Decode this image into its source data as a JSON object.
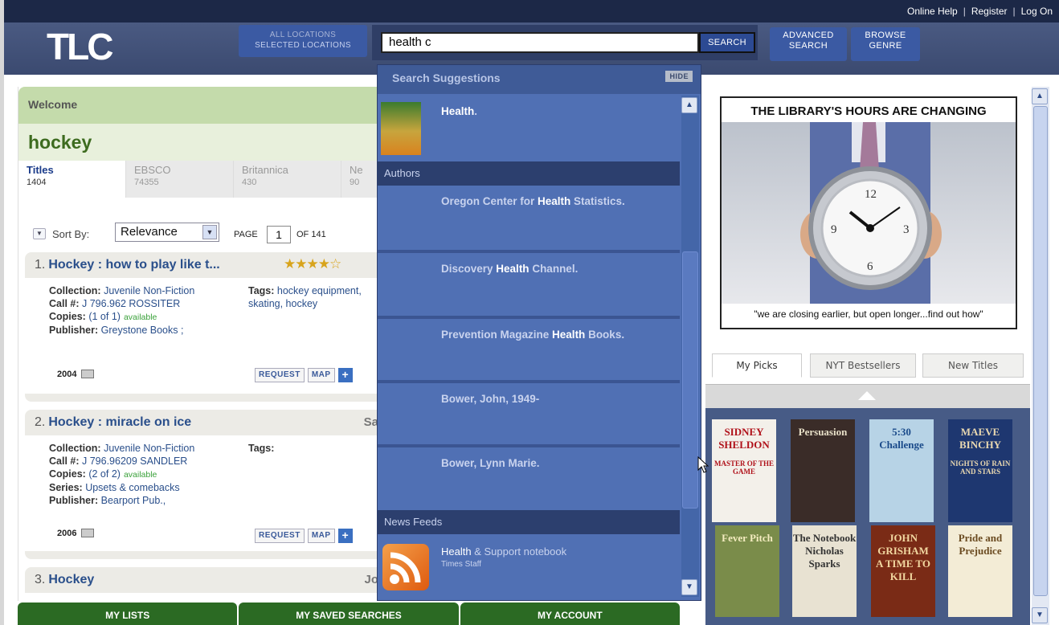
{
  "header": {
    "logo_text": "TLC",
    "top_links": [
      "Online Help",
      "Register",
      "Log On"
    ],
    "locations": {
      "all": "ALL LOCATIONS",
      "selected": "SELECTED LOCATIONS"
    },
    "search": {
      "value": "health c",
      "button": "SEARCH"
    },
    "advanced": {
      "line1": "ADVANCED",
      "line2": "SEARCH"
    },
    "browse": {
      "line1": "BROWSE",
      "line2": "GENRE"
    }
  },
  "welcome": {
    "label": "Welcome",
    "user": "hockey"
  },
  "source_tabs": [
    {
      "name": "Titles",
      "count": "1404"
    },
    {
      "name": "EBSCO",
      "count": "74355"
    },
    {
      "name": "Britannica",
      "count": "430"
    },
    {
      "name": "Ne",
      "count": "90"
    }
  ],
  "sort": {
    "label": "Sort By:",
    "value": "Relevance",
    "page_label": "PAGE",
    "page": "1",
    "of": "OF 141"
  },
  "results": [
    {
      "num": "1.",
      "title": "Hockey : how to play like t...",
      "right": "",
      "collection_label": "Collection:",
      "collection": "Juvenile Non-Fiction",
      "call_label": "Call #:",
      "call": "J 796.962 ROSSITER",
      "copies_label": "Copies:",
      "copies": "(1 of 1)",
      "avail": "available",
      "series_label": "",
      "series": "",
      "pub_label": "Publisher:",
      "pub": "Greystone Books ;",
      "tags_label": "Tags:",
      "tags": "hockey equipment, skating, hockey",
      "year": "2004",
      "rating": 4
    },
    {
      "num": "2.",
      "title": "Hockey : miracle on ice",
      "right": "Sa",
      "collection_label": "Collection:",
      "collection": "Juvenile Non-Fiction",
      "call_label": "Call #:",
      "call": "J 796.96209 SANDLER",
      "copies_label": "Copies:",
      "copies": "(2 of 2)",
      "avail": "available",
      "series_label": "Series:",
      "series": "Upsets & comebacks",
      "pub_label": "Publisher:",
      "pub": "Bearport Pub.,",
      "tags_label": "Tags:",
      "tags": "",
      "year": "2006"
    },
    {
      "num": "3.",
      "title": "Hockey",
      "right": "Jo"
    }
  ],
  "actions": {
    "request": "REQUEST",
    "map": "MAP",
    "plus": "+"
  },
  "bottom_tabs": [
    "MY LISTS",
    "MY SAVED SEARCHES",
    "MY ACCOUNT"
  ],
  "suggestions": {
    "title": "Search Suggestions",
    "hide": "HIDE",
    "titles": [
      {
        "hl": "Health",
        "rest": "."
      }
    ],
    "authors_label": "Authors",
    "authors": [
      {
        "pre": "Oregon Center for ",
        "hl": "Health",
        "post": " Statistics."
      },
      {
        "pre": "Discovery ",
        "hl": "Health",
        "post": " Channel."
      },
      {
        "pre": "Prevention Magazine ",
        "hl": "Health",
        "post": " Books."
      },
      {
        "pre": "Bower, John, 1949-",
        "hl": "",
        "post": ""
      },
      {
        "pre": "Bower, Lynn Marie.",
        "hl": "",
        "post": ""
      }
    ],
    "news_label": "News Feeds",
    "news": {
      "hl": "Health",
      "rest": " & Support notebook",
      "source": "Times Staff"
    }
  },
  "promo": {
    "title": "THE LIBRARY'S HOURS ARE CHANGING",
    "caption": "\"we are closing earlier, but open longer...find out how\"",
    "clock_numbers": [
      "12",
      "3",
      "6",
      "9"
    ]
  },
  "pick_tabs": [
    "My Picks",
    "NYT Bestsellers",
    "New Titles"
  ],
  "covers": [
    {
      "line1": "SIDNEY",
      "line2": "SHELDON",
      "line3": "MASTER OF THE GAME",
      "bg": "#f3f0ea",
      "fg": "#b0111a"
    },
    {
      "line1": "Persuasion",
      "line2": "",
      "line3": "",
      "bg": "#3a2c28",
      "fg": "#e8e0c8"
    },
    {
      "line1": "5:30",
      "line2": "Challenge",
      "line3": "",
      "bg": "#b7d3e6",
      "fg": "#1a4a8a"
    },
    {
      "line1": "MAEVE",
      "line2": "BINCHY",
      "line3": "NIGHTS OF RAIN AND STARS",
      "bg": "#1e3770",
      "fg": "#e9d8b0"
    },
    {
      "line1": "Fever Pitch",
      "line2": "",
      "line3": "",
      "bg": "#7a8c4a",
      "fg": "#f4ecc0"
    },
    {
      "line1": "The Notebook",
      "line2": "Nicholas Sparks",
      "line3": "",
      "bg": "#e8e2d2",
      "fg": "#333"
    },
    {
      "line1": "JOHN GRISHAM",
      "line2": "A TIME TO KILL",
      "line3": "",
      "bg": "#7a2b16",
      "fg": "#f1d7a0"
    },
    {
      "line1": "Pride and Prejudice",
      "line2": "",
      "line3": "",
      "bg": "#f3ecd6",
      "fg": "#6a4a20"
    }
  ]
}
